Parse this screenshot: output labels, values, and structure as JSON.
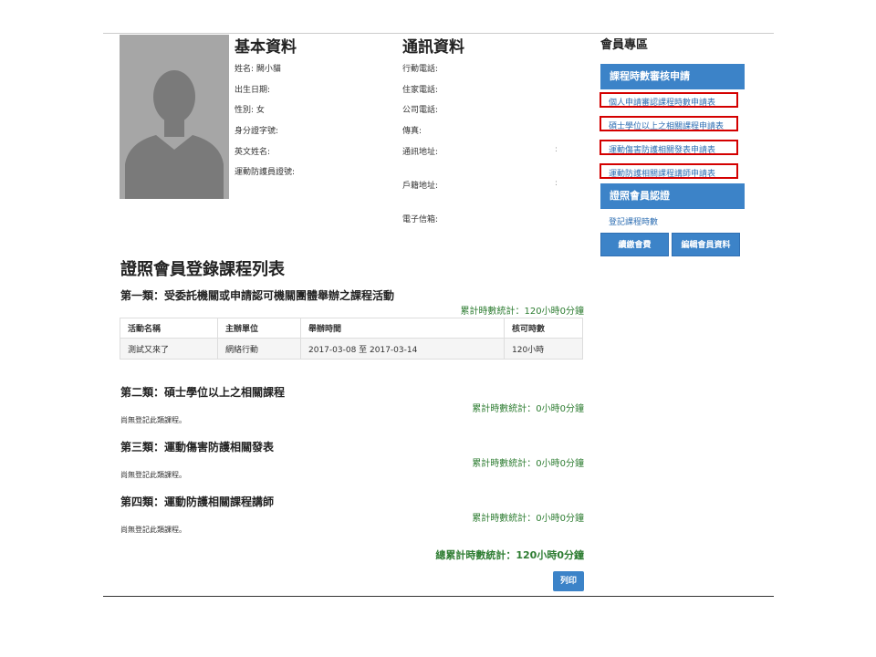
{
  "profile": {
    "basic_title": "基本資料",
    "contact_title": "通訊資料",
    "basic_fields": [
      "姓名: 闕小貓",
      "出生日期:",
      "性別: 女",
      "身分證字號:",
      "英文姓名:",
      "運動防護員證號:"
    ],
    "contact_fields": [
      "行動電話:",
      "住家電話:",
      "公司電話:",
      "傳真:",
      "通訊地址:",
      "戶籍地址:",
      "電子信箱:"
    ],
    "address_colon": ":",
    "residence_colon": ":"
  },
  "sidebar": {
    "title": "會員專區",
    "section1_head": "課程時數審核申請",
    "links": [
      "個人申請審認課程時數申請表",
      "碩士學位以上之相關課程申請表",
      "運動傷害防護相關發表申請表",
      "運動防護相關課程講師申請表"
    ],
    "section2_head": "證照會員認證",
    "register_link": "登記課程時數",
    "renew_button": "續繳會費",
    "edit_button": "編輯會員資料"
  },
  "main": {
    "title": "證照會員登錄課程列表",
    "categories": [
      {
        "title": "第一類：受委託機關或申請認可機關團體舉辦之課程活動",
        "total": "累計時數統計：120小時0分鐘",
        "headers": [
          "活動名稱",
          "主辦單位",
          "舉辦時間",
          "核可時數"
        ],
        "rows": [
          [
            "測試又來了",
            "網絡行動",
            "2017-03-08 至 2017-03-14",
            "120小時"
          ]
        ]
      },
      {
        "title": "第二類：碩士學位以上之相關課程",
        "total": "累計時數統計：0小時0分鐘",
        "empty": "尚無登記此類課程。"
      },
      {
        "title": "第三類：運動傷害防護相關發表",
        "total": "累計時數統計：0小時0分鐘",
        "empty": "尚無登記此類課程。"
      },
      {
        "title": "第四類：運動防護相關課程講師",
        "total": "累計時數統計：0小時0分鐘",
        "empty": "尚無登記此類課程。"
      }
    ],
    "grand_total": "總累計時數統計：120小時0分鐘",
    "print_button": "列印"
  },
  "colors": {
    "accent": "#3c83c8",
    "highlight_border": "#d40000",
    "total_text": "#2e7d32"
  },
  "icons": {
    "avatar": "person-silhouette-icon"
  }
}
